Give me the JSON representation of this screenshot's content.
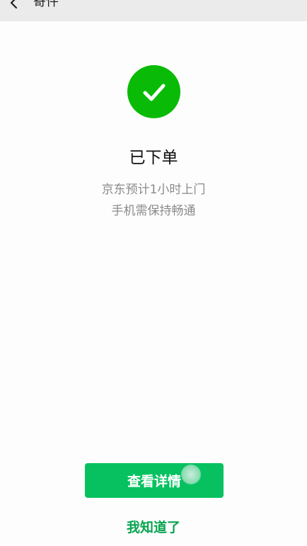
{
  "header": {
    "title": "寄件",
    "back_icon": "chevron-left-icon"
  },
  "status": {
    "icon": "checkmark-icon",
    "icon_color": "#09bb07",
    "title": "已下单",
    "line1": "京东预计1小时上门",
    "line2": "手机需保持畅通"
  },
  "actions": {
    "view_details_label": "查看详情",
    "acknowledge_label": "我知道了",
    "accent_color": "#07c160"
  }
}
